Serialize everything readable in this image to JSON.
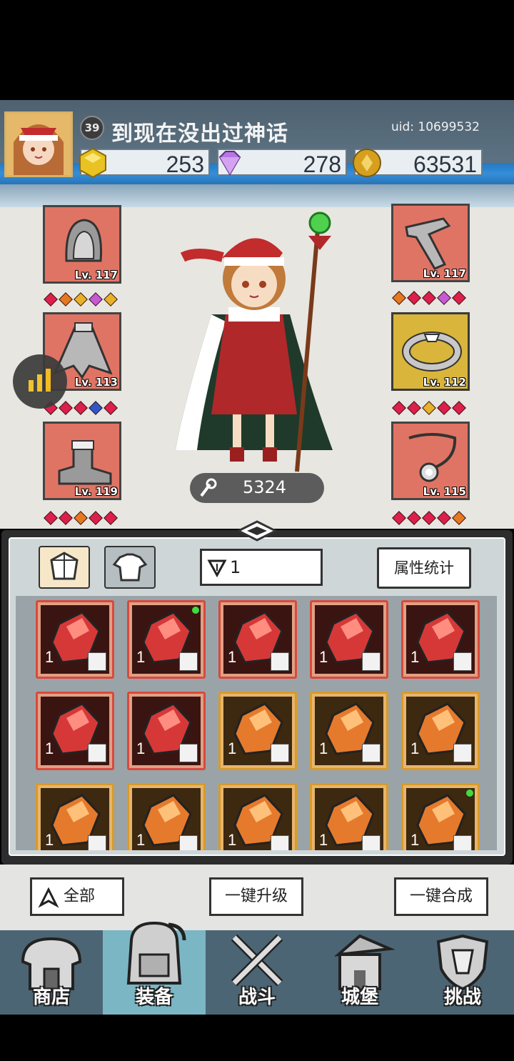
{
  "player": {
    "level": "39",
    "name": "到现在没出过神话",
    "uid": "uid: 10699532"
  },
  "currencies": [
    {
      "icon": "gold-crystal-icon",
      "value": "253",
      "color": "#e8c321"
    },
    {
      "icon": "purple-diamond-icon",
      "value": "278",
      "color": "#b777e0"
    },
    {
      "icon": "gold-coin-icon",
      "value": "63531",
      "color": "#d6a01e"
    }
  ],
  "equipment": {
    "left": [
      {
        "item": "helmet",
        "level": "Lv. 117",
        "gems": [
          "red",
          "orange",
          "yellow",
          "purple",
          "yellow"
        ]
      },
      {
        "item": "cape",
        "level": "Lv. 113",
        "gems": [
          "red",
          "red",
          "red",
          "blue",
          "red"
        ]
      },
      {
        "item": "boots",
        "level": "Lv. 119",
        "gems": [
          "red",
          "red",
          "orange",
          "red",
          "red"
        ]
      }
    ],
    "right": [
      {
        "item": "gauntlet",
        "level": "Lv. 117",
        "gems": [
          "orange",
          "red",
          "red",
          "purple",
          "red"
        ]
      },
      {
        "item": "ring",
        "level": "Lv. 112",
        "gems": [
          "red",
          "red",
          "yellow",
          "red",
          "red"
        ],
        "highlight": true
      },
      {
        "item": "necklace",
        "level": "Lv. 115",
        "gems": [
          "red",
          "red",
          "red",
          "red",
          "orange"
        ]
      }
    ]
  },
  "power": "5324",
  "inventory": {
    "filter_value": "1",
    "stats_button": "属性统计",
    "items": [
      {
        "rarity": "red",
        "qty": "1",
        "slot": "ring-slot-icon",
        "new": false
      },
      {
        "rarity": "red",
        "qty": "1",
        "slot": "cape-slot-icon",
        "new": true
      },
      {
        "rarity": "red",
        "qty": "1",
        "slot": "gauntlet-slot-icon",
        "new": false
      },
      {
        "rarity": "red",
        "qty": "1",
        "slot": "helmet-slot-icon",
        "new": false
      },
      {
        "rarity": "red",
        "qty": "1",
        "slot": "necklace-slot-icon",
        "new": false
      },
      {
        "rarity": "red",
        "qty": "1",
        "slot": "necklace-slot-icon",
        "new": false
      },
      {
        "rarity": "red",
        "qty": "1",
        "slot": "necklace-slot-icon",
        "new": false
      },
      {
        "rarity": "orange",
        "qty": "1",
        "slot": "ring-slot-icon",
        "new": false
      },
      {
        "rarity": "orange",
        "qty": "1",
        "slot": "ring-slot-icon",
        "new": false
      },
      {
        "rarity": "orange",
        "qty": "1",
        "slot": "ring-slot-icon",
        "new": false
      },
      {
        "rarity": "orange",
        "qty": "1",
        "slot": "ring-slot-icon",
        "new": false
      },
      {
        "rarity": "orange",
        "qty": "1",
        "slot": "boots-slot-icon",
        "new": false
      },
      {
        "rarity": "orange",
        "qty": "1",
        "slot": "ring-slot-icon",
        "new": false
      },
      {
        "rarity": "orange",
        "qty": "1",
        "slot": "boots-slot-icon",
        "new": false
      },
      {
        "rarity": "orange",
        "qty": "1",
        "slot": "boots-slot-icon",
        "new": true
      }
    ]
  },
  "actions": {
    "all": "全部",
    "upgrade_all": "一键升级",
    "merge_all": "一键合成"
  },
  "nav": [
    {
      "label": "商店",
      "icon": "shop-icon",
      "active": false
    },
    {
      "label": "装备",
      "icon": "backpack-icon",
      "active": true
    },
    {
      "label": "战斗",
      "icon": "crossed-swords-icon",
      "active": false
    },
    {
      "label": "城堡",
      "icon": "castle-icon",
      "active": false
    },
    {
      "label": "挑战",
      "icon": "challenge-shield-icon",
      "active": false
    }
  ]
}
